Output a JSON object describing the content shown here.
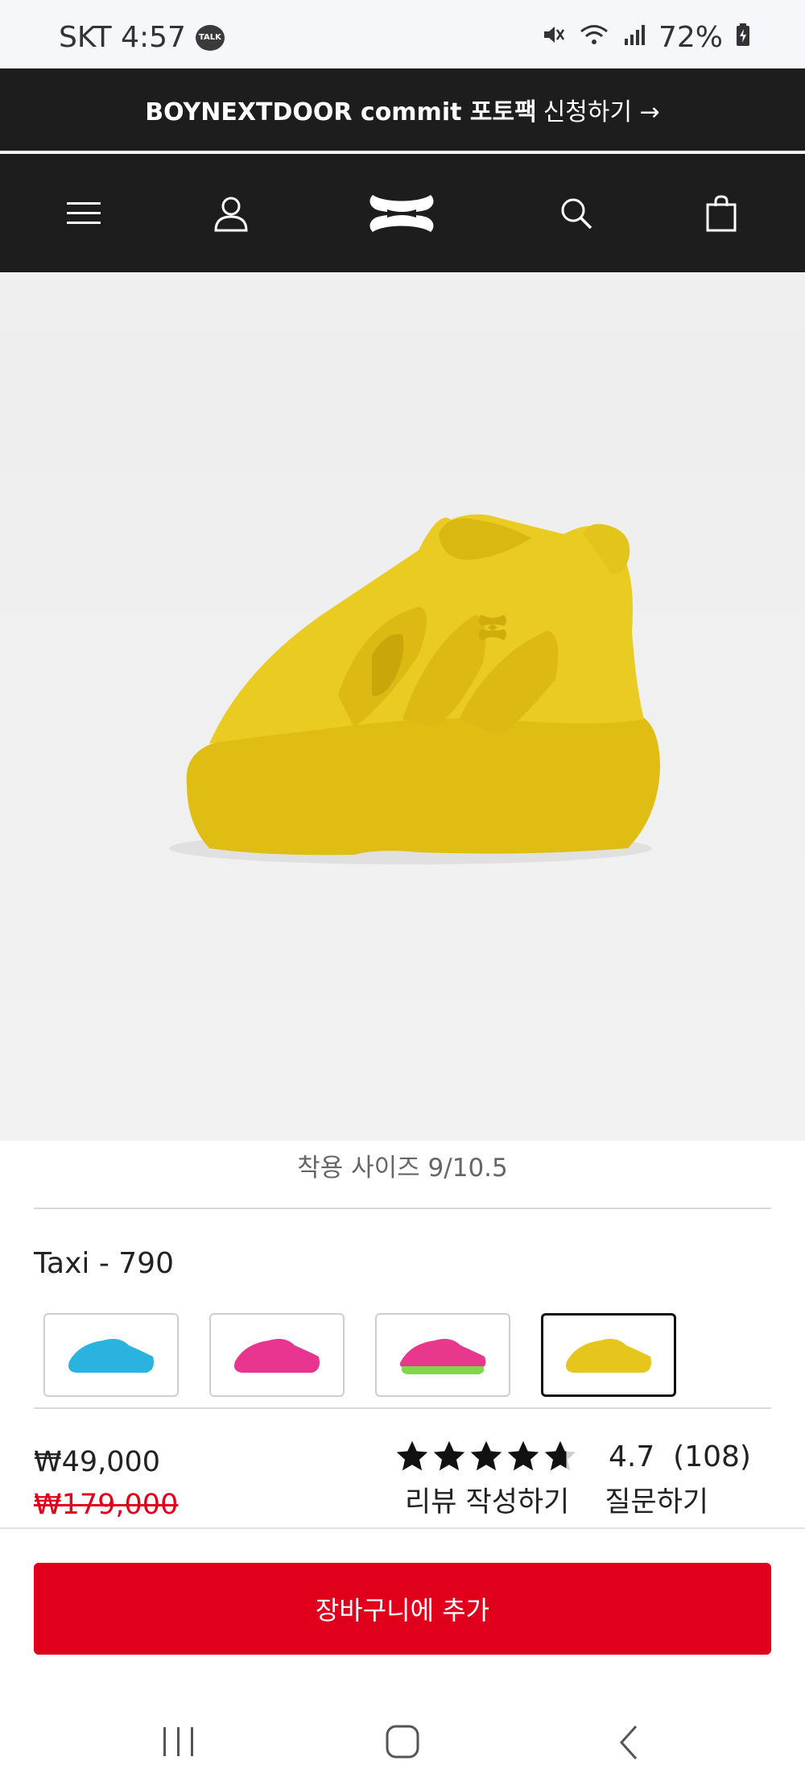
{
  "status_bar": {
    "carrier_time": "SKT 4:57",
    "talk_badge": "TALK",
    "battery": "72%"
  },
  "promo_banner": {
    "bold_text": "BOYNEXTDOOR commit 포토팩",
    "action_text": "신청하기 →"
  },
  "nav": {
    "icons": [
      "menu-icon",
      "account-icon",
      "under-armour-logo",
      "search-icon",
      "shopping-bag-icon"
    ]
  },
  "product": {
    "fit_size": "착용 사이즈 9/10.5",
    "color_name": "Taxi - 790",
    "swatches": [
      {
        "name": "blue",
        "color": "#2ab3de"
      },
      {
        "name": "pink",
        "color": "#e83590"
      },
      {
        "name": "pink-green",
        "color": "#e8388e"
      },
      {
        "name": "yellow",
        "color": "#e6c51c",
        "selected": true
      }
    ],
    "price": "₩49,000",
    "original_price": "₩179,000",
    "rating_value": "4.7",
    "review_count": "(108)",
    "rating_stars": 4.7,
    "write_review": "리뷰 작성하기",
    "ask_question": "질문하기",
    "add_to_cart": "장바구니에 추가"
  },
  "colors": {
    "accent_red": "#e0001b",
    "header_dark": "#1d1d1d",
    "shoe_yellow": "#e7c81c"
  }
}
